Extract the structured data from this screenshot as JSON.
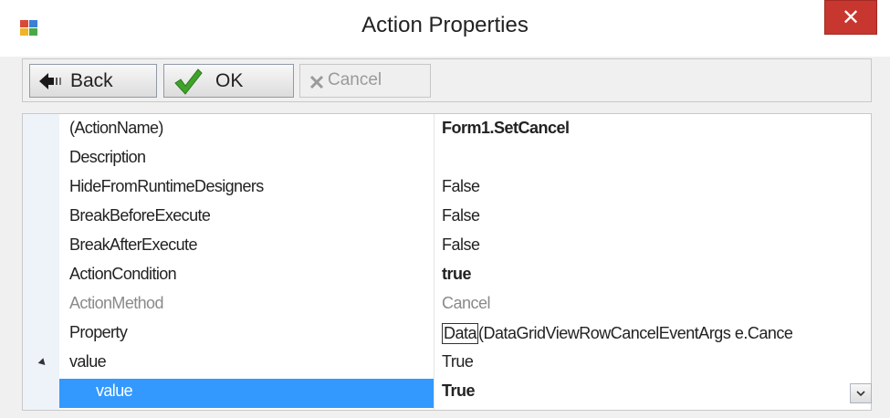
{
  "window": {
    "title": "Action Properties",
    "close_label": "✕"
  },
  "toolbar": {
    "back_label": "Back",
    "ok_label": "OK",
    "cancel_label": "Cancel"
  },
  "properties": {
    "rows": [
      {
        "name": "(ActionName)",
        "value": "Form1.SetCancel"
      },
      {
        "name": "Description",
        "value": ""
      },
      {
        "name": "HideFromRuntimeDesigners",
        "value": "False"
      },
      {
        "name": "BreakBeforeExecute",
        "value": "False"
      },
      {
        "name": "BreakAfterExecute",
        "value": "False"
      },
      {
        "name": "ActionCondition",
        "value": "true"
      },
      {
        "name": "ActionMethod",
        "value": "Cancel"
      },
      {
        "name": "Property",
        "value_prefix": "Data",
        "value": "(DataGridViewRowCancelEventArgs e.Cance"
      },
      {
        "name": "value",
        "value": "True"
      },
      {
        "name": "value",
        "value": "True"
      }
    ]
  },
  "colors": {
    "selection": "#3399ff",
    "close_button": "#c7372f",
    "ok_check": "#3fa22a"
  }
}
